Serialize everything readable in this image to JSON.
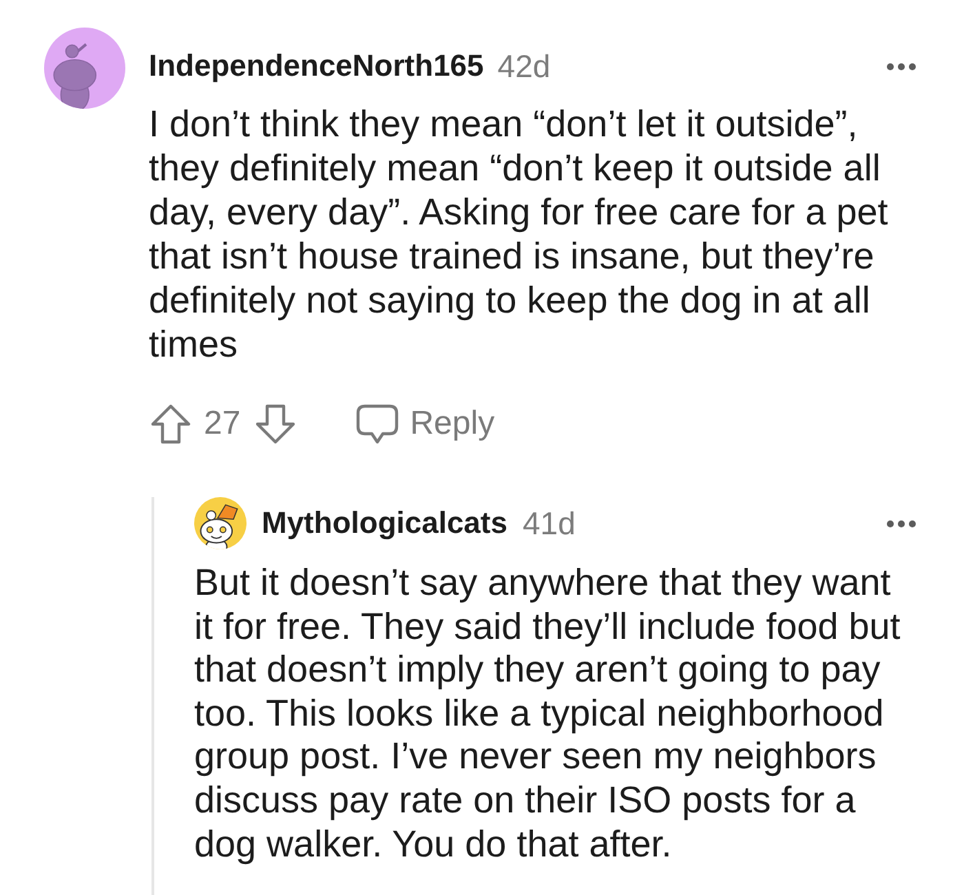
{
  "comments": [
    {
      "author": "IndependenceNorth165",
      "age": "42d",
      "body": "I don’t think they mean “don’t let it outside”, they definitely mean “don’t keep it outside all day, every day”. Asking for free care for a pet that isn’t house trained is insane, but they’re definitely not saying to keep the dog in at all times",
      "votes": "27",
      "reply_label": "Reply",
      "replies": [
        {
          "author": "Mythologicalcats",
          "age": "41d",
          "body": "But it doesn’t say anywhere that they want it for free. They said they’ll include food but that doesn’t imply they aren’t going to pay too. This looks like a typical neighborhood group post. I’ve never seen my neighbors discuss pay rate on their ISO posts for a dog walker. You do that after."
        }
      ]
    }
  ]
}
